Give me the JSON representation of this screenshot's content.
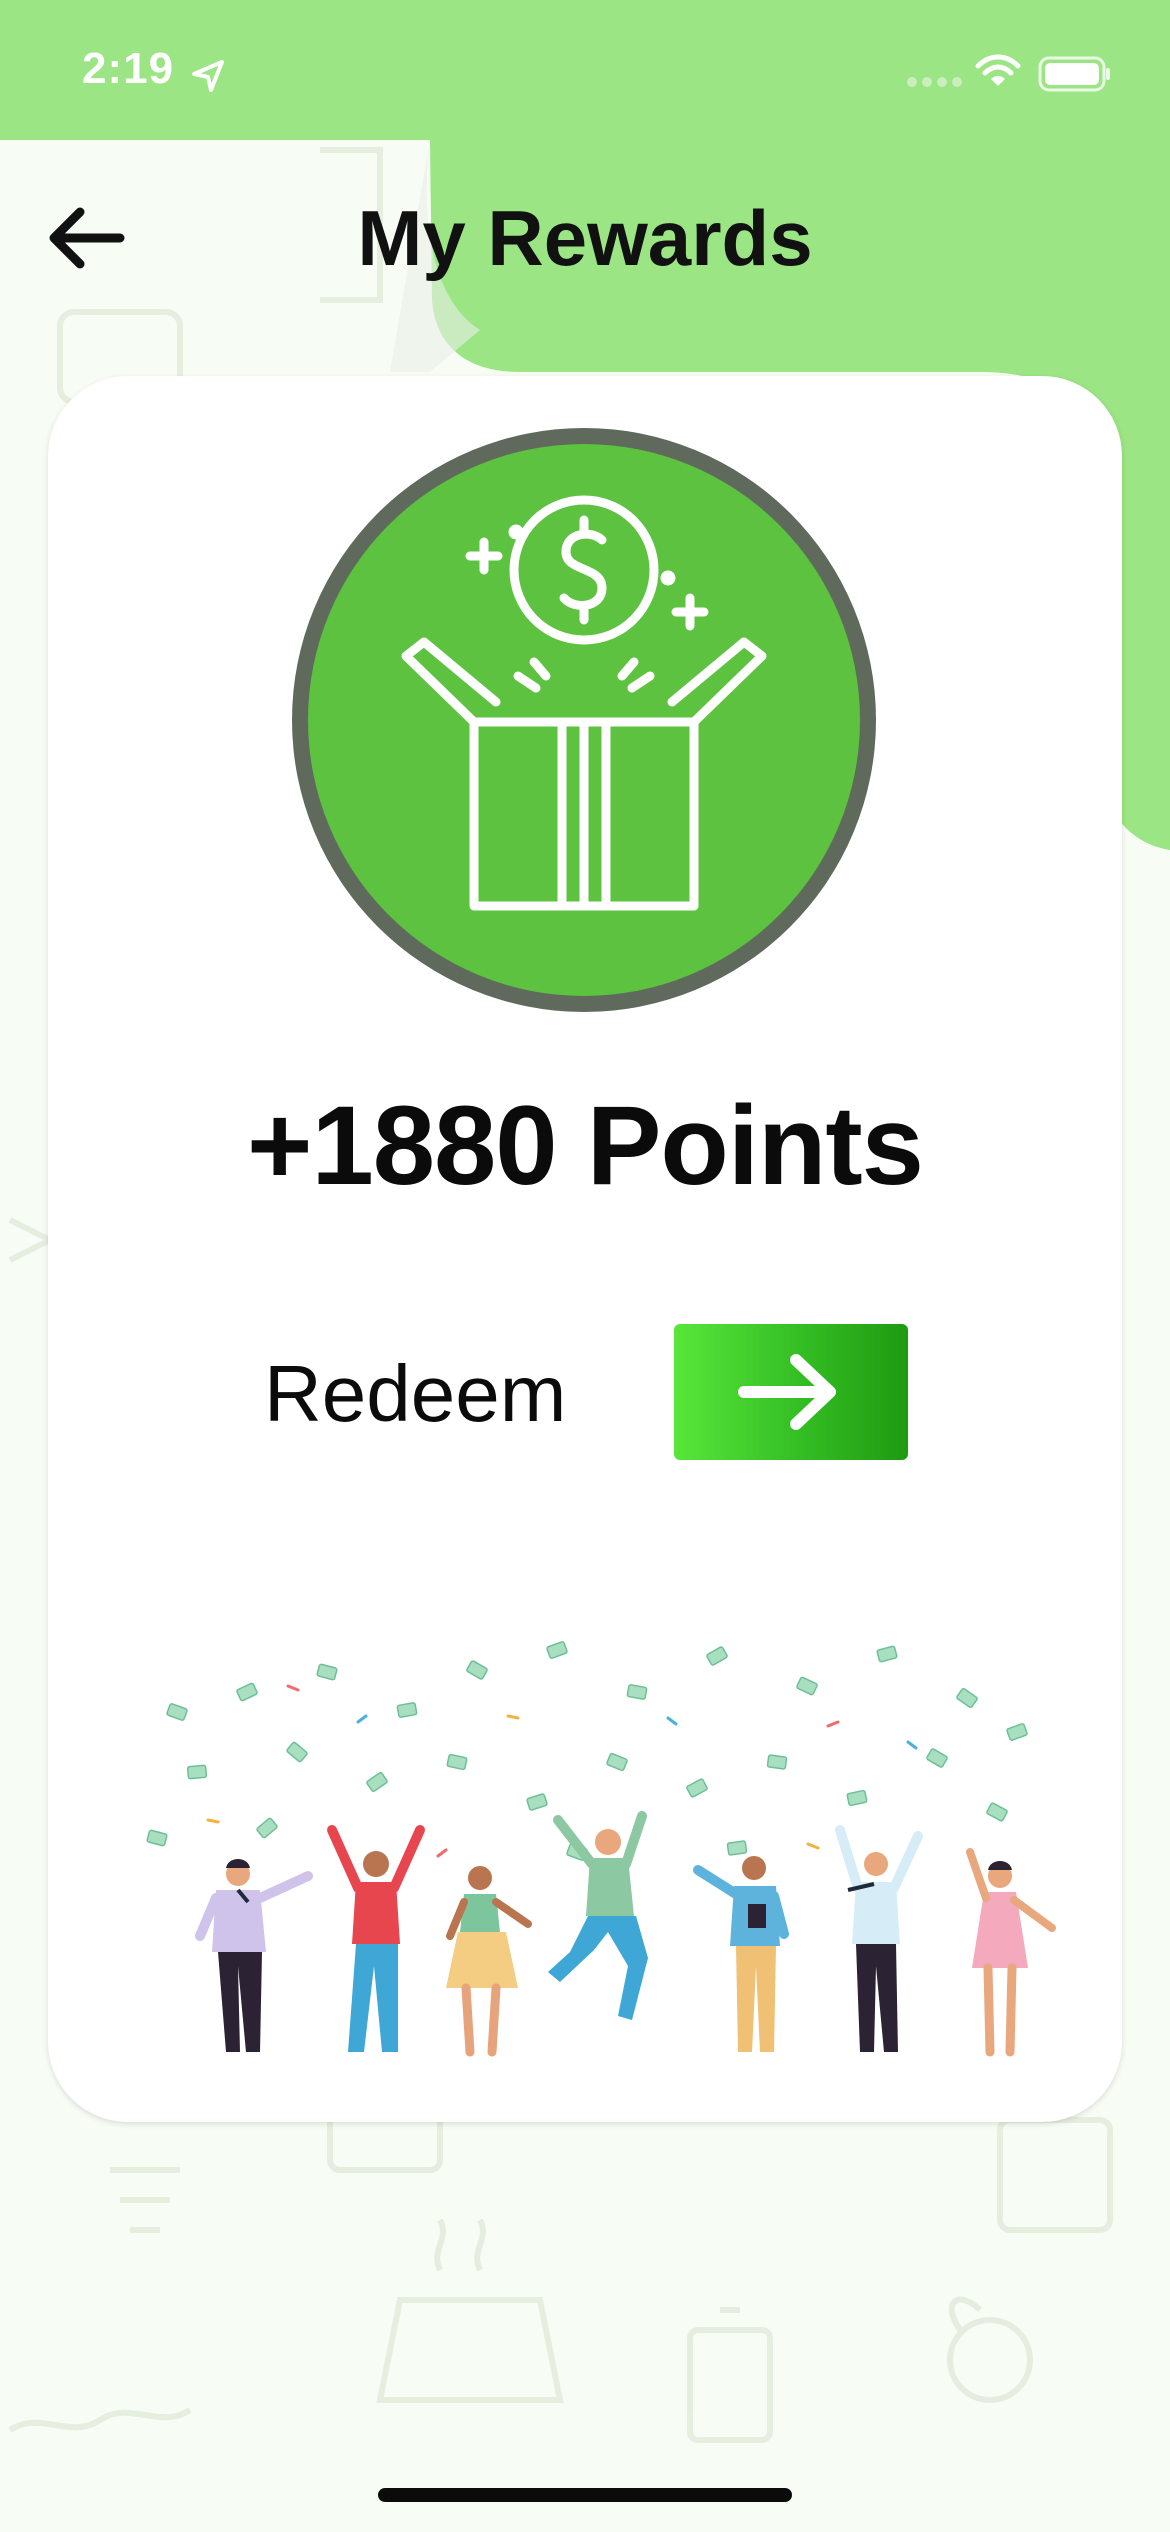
{
  "status_bar": {
    "time": "2:19",
    "icons": [
      "location-arrow-icon",
      "signal-icon",
      "wifi-icon",
      "battery-icon"
    ]
  },
  "header": {
    "title": "My Rewards",
    "back_icon": "arrow-left-icon"
  },
  "rewards": {
    "points_label": "+1880 Points",
    "badge_icon": "gift-box-dollar-icon",
    "redeem_label": "Redeem",
    "redeem_icon": "arrow-right-icon",
    "illustration": "people-celebrating-illustration"
  },
  "colors": {
    "accent_green": "#9be584",
    "badge_green": "#5cc23f",
    "badge_ring": "#5f5f5f",
    "button_green_start": "#58e63a",
    "button_green_end": "#1f9a12",
    "text_dark": "#0b0b0b",
    "card_background": "#ffffff",
    "page_background": "#f7fcf4"
  }
}
